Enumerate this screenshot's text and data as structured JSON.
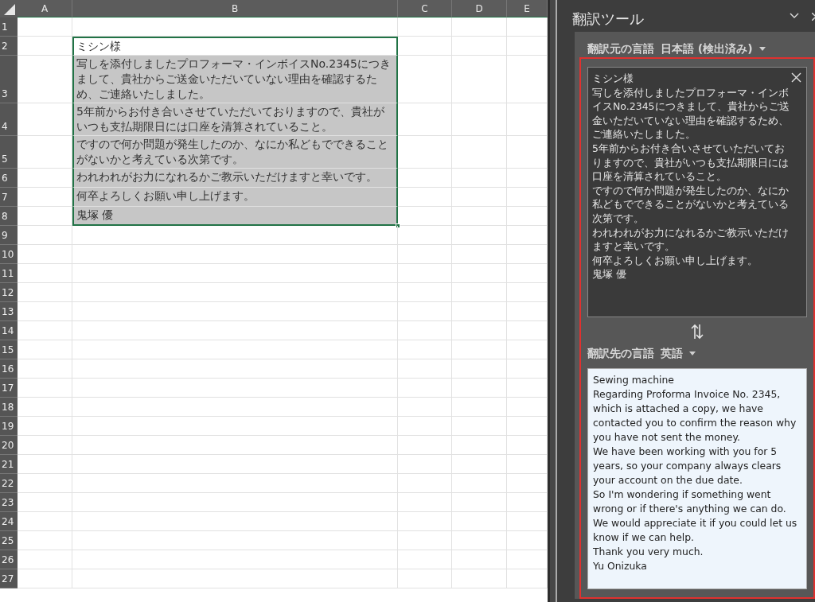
{
  "sheet": {
    "columns": [
      {
        "label": "A"
      },
      {
        "label": "B"
      },
      {
        "label": "C"
      },
      {
        "label": "D"
      },
      {
        "label": "E"
      }
    ],
    "rows": [
      {
        "number": "1",
        "selected": false,
        "active": false
      },
      {
        "number": "2",
        "b": "ミシン様",
        "selected": true,
        "active": true
      },
      {
        "number": "3",
        "b": "写しを添付しましたプロフォーマ・インボイスNo.2345につきまして、貴社からご送金いただいていない理由を確認するため、ご連絡いたしました。",
        "selected": true,
        "active": false
      },
      {
        "number": "4",
        "b": "5年前からお付き合いさせていただいておりますので、貴社がいつも支払期限日には口座を清算されていること。",
        "selected": true,
        "active": false
      },
      {
        "number": "5",
        "b": "ですので何か問題が発生したのか、なにか私どもでできることがないかと考えている次第です。",
        "selected": true,
        "active": false
      },
      {
        "number": "6",
        "b": "われわれがお力になれるかご教示いただけますと幸いです。",
        "selected": true,
        "active": false
      },
      {
        "number": "7",
        "b": "何卒よろしくお願い申し上げます。",
        "selected": true,
        "active": false
      },
      {
        "number": "8",
        "b": "鬼塚 優",
        "selected": true,
        "active": false
      },
      {
        "number": "9",
        "selected": false,
        "active": false
      },
      {
        "number": "10",
        "selected": false,
        "active": false
      },
      {
        "number": "11",
        "selected": false,
        "active": false
      },
      {
        "number": "12",
        "selected": false,
        "active": false
      },
      {
        "number": "13",
        "selected": false,
        "active": false
      },
      {
        "number": "14",
        "selected": false,
        "active": false
      },
      {
        "number": "15",
        "selected": false,
        "active": false
      },
      {
        "number": "16",
        "selected": false,
        "active": false
      },
      {
        "number": "17",
        "selected": false,
        "active": false
      },
      {
        "number": "18",
        "selected": false,
        "active": false
      },
      {
        "number": "19",
        "selected": false,
        "active": false
      },
      {
        "number": "20",
        "selected": false,
        "active": false
      },
      {
        "number": "21",
        "selected": false,
        "active": false
      },
      {
        "number": "22",
        "selected": false,
        "active": false
      },
      {
        "number": "23",
        "selected": false,
        "active": false
      },
      {
        "number": "24",
        "selected": false,
        "active": false
      },
      {
        "number": "25",
        "selected": false,
        "active": false
      },
      {
        "number": "26",
        "selected": false,
        "active": false
      },
      {
        "number": "27",
        "selected": false,
        "active": false
      }
    ]
  },
  "pane": {
    "title": "翻訳ツール",
    "source": {
      "label": "翻訳元の言語",
      "language": "日本語 (検出済み)",
      "lines": [
        "ミシン様",
        "写しを添付しましたプロフォーマ・インボイスNo.2345につきまして、貴社からご送金いただいていない理由を確認するため、ご連絡いたしました。",
        "5年前からお付き合いさせていただいておりますので、貴社がいつも支払期限日には口座を清算されていること。",
        "ですので何か問題が発生したのか、なにか私どもでできることがないかと考えている次第です。",
        "われわれがお力になれるかご教示いただけますと幸いです。",
        "何卒よろしくお願い申し上げます。",
        "鬼塚 優"
      ]
    },
    "target": {
      "label": "翻訳先の言語",
      "language": "英語",
      "lines": [
        "Sewing machine",
        "Regarding Proforma Invoice No. 2345, which is attached a copy, we have contacted you to confirm the reason why you have not sent the money.",
        "We have been working with you for 5 years, so your company always clears your account on the due date.",
        "So I'm wondering if something went wrong or if there's anything we can do.",
        "We would appreciate it if you could let us know if we can help.",
        "Thank you very much.",
        "Yu Onizuka"
      ]
    }
  }
}
